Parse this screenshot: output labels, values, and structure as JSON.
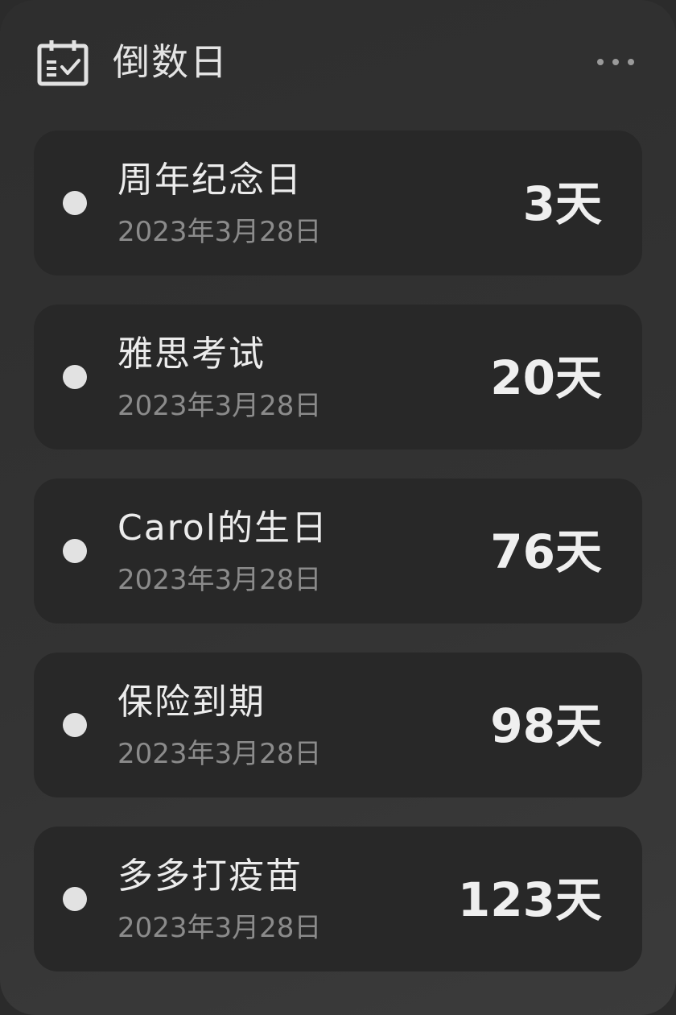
{
  "header": {
    "icon": "calendar-check-icon",
    "title": "倒数日",
    "more_icon": "more-horizontal-icon"
  },
  "items": [
    {
      "name": "周年纪念日",
      "date": "2023年3月28日",
      "days": "3天"
    },
    {
      "name": "雅思考试",
      "date": "2023年3月28日",
      "days": "20天"
    },
    {
      "name": "Carol的生日",
      "date": "2023年3月28日",
      "days": "76天"
    },
    {
      "name": "保险到期",
      "date": "2023年3月28日",
      "days": "98天"
    },
    {
      "name": "多多打疫苗",
      "date": "2023年3月28日",
      "days": "123天"
    }
  ],
  "colors": {
    "background": "#333333",
    "card": "#282828",
    "text_primary": "#ececec",
    "text_secondary": "#8b8b8b",
    "dot": "#e2e2e2"
  }
}
